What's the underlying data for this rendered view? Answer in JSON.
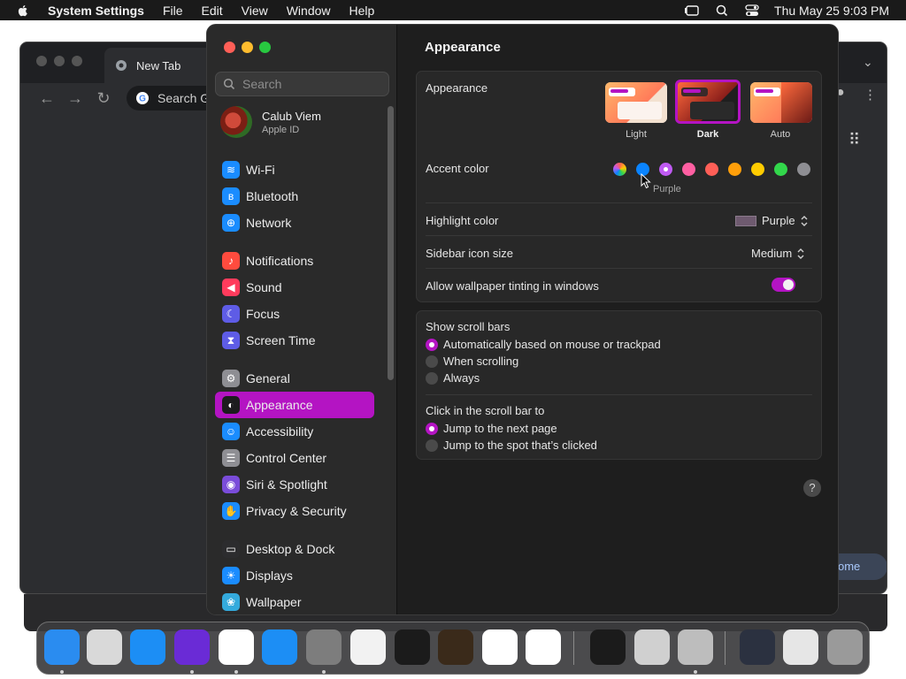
{
  "menubar": {
    "app": "System Settings",
    "items": [
      "File",
      "Edit",
      "View",
      "Window",
      "Help"
    ],
    "clock": "Thu May 25  9:03 PM"
  },
  "chrome": {
    "tab_title": "New Tab",
    "omnibox_placeholder": "Search Go",
    "customize_label": "ome"
  },
  "sidebar": {
    "search_placeholder": "Search",
    "profile": {
      "name": "Calub Viem",
      "sub": "Apple ID"
    },
    "items": [
      {
        "label": "Wi-Fi",
        "color": "#1a8cff",
        "icon": "wifi-icon",
        "glyph": "≋"
      },
      {
        "label": "Bluetooth",
        "color": "#1a8cff",
        "icon": "bluetooth-icon",
        "glyph": "ʙ"
      },
      {
        "label": "Network",
        "color": "#1a8cff",
        "icon": "globe-icon",
        "glyph": "⊕"
      },
      {
        "label": "Notifications",
        "color": "#ff4b3e",
        "icon": "bell-icon",
        "glyph": "♪"
      },
      {
        "label": "Sound",
        "color": "#ff3b5c",
        "icon": "speaker-icon",
        "glyph": "◀"
      },
      {
        "label": "Focus",
        "color": "#5e5ce6",
        "icon": "moon-icon",
        "glyph": "☾"
      },
      {
        "label": "Screen Time",
        "color": "#5e5ce6",
        "icon": "hourglass-icon",
        "glyph": "⧗"
      },
      {
        "label": "General",
        "color": "#8e8e93",
        "icon": "gear-icon",
        "glyph": "⚙"
      },
      {
        "label": "Appearance",
        "color": "#1c1c1e",
        "icon": "appearance-icon",
        "glyph": "◐"
      },
      {
        "label": "Accessibility",
        "color": "#1a8cff",
        "icon": "accessibility-icon",
        "glyph": "☺"
      },
      {
        "label": "Control Center",
        "color": "#8e8e93",
        "icon": "switches-icon",
        "glyph": "☰"
      },
      {
        "label": "Siri & Spotlight",
        "color": "#7a4cd9",
        "icon": "siri-icon",
        "glyph": "◉"
      },
      {
        "label": "Privacy & Security",
        "color": "#1a8cff",
        "icon": "hand-icon",
        "glyph": "✋"
      },
      {
        "label": "Desktop & Dock",
        "color": "#2c2c2e",
        "icon": "dock-icon",
        "glyph": "▭"
      },
      {
        "label": "Displays",
        "color": "#1a8cff",
        "icon": "sun-icon",
        "glyph": "☀"
      },
      {
        "label": "Wallpaper",
        "color": "#34aadc",
        "icon": "wallpaper-icon",
        "glyph": "❀"
      }
    ],
    "active_index": 8
  },
  "content": {
    "title": "Appearance",
    "appearance": {
      "label": "Appearance",
      "options": [
        "Light",
        "Dark",
        "Auto"
      ],
      "selected": "Dark"
    },
    "accent": {
      "label": "Accent color",
      "colors": [
        "multicolor",
        "#0a84ff",
        "#bf5af2",
        "#ff5fa2",
        "#ff5f57",
        "#ff9f0a",
        "#ffcc00",
        "#32d74b",
        "#8e8e93"
      ],
      "selected_index": 2,
      "selected_name": "Purple"
    },
    "highlight": {
      "label": "Highlight color",
      "value": "Purple"
    },
    "sidebar_icon_size": {
      "label": "Sidebar icon size",
      "value": "Medium"
    },
    "wallpaper_tinting": {
      "label": "Allow wallpaper tinting in windows",
      "on": true
    },
    "scroll_bars": {
      "label": "Show scroll bars",
      "options": [
        "Automatically based on mouse or trackpad",
        "When scrolling",
        "Always"
      ],
      "selected_index": 0
    },
    "click_scroll": {
      "label": "Click in the scroll bar to",
      "options": [
        "Jump to the next page",
        "Jump to the spot that’s clicked"
      ],
      "selected_index": 0
    },
    "help": "?"
  },
  "dock": {
    "apps": [
      {
        "name": "finder-icon",
        "bg": "#2a8cf0",
        "dot": true
      },
      {
        "name": "launchpad-icon",
        "bg": "#d9d9d9",
        "dot": false
      },
      {
        "name": "safari-icon",
        "bg": "#1c8ef5",
        "dot": false
      },
      {
        "name": "firefox-icon",
        "bg": "#6a2bd6",
        "dot": true
      },
      {
        "name": "chrome-icon",
        "bg": "#ffffff",
        "dot": true
      },
      {
        "name": "app-store-icon",
        "bg": "#1c8ef5",
        "dot": false
      },
      {
        "name": "system-settings-icon",
        "bg": "#7d7d7d",
        "dot": true
      },
      {
        "name": "textedit-icon",
        "bg": "#f2f2f2",
        "dot": false
      },
      {
        "name": "terminal-icon",
        "bg": "#1b1b1b",
        "dot": false
      },
      {
        "name": "garageband-icon",
        "bg": "#3a2a1a",
        "dot": false
      },
      {
        "name": "vscode-icon",
        "bg": "#ffffff",
        "dot": false
      },
      {
        "name": "visual-studio-icon",
        "bg": "#ffffff",
        "dot": false
      },
      {
        "name": "activity-monitor-icon",
        "bg": "#1b1b1b",
        "dot": false
      },
      {
        "name": "chess-icon",
        "bg": "#d0d0d0",
        "dot": false
      },
      {
        "name": "migration-icon",
        "bg": "#bdbdbd",
        "dot": true
      },
      {
        "name": "applications-folder-icon",
        "bg": "#2b3140",
        "dot": false
      },
      {
        "name": "downloads-folder-icon",
        "bg": "#e6e6e6",
        "dot": false
      },
      {
        "name": "trash-icon",
        "bg": "#9a9a9a",
        "dot": false
      }
    ]
  }
}
